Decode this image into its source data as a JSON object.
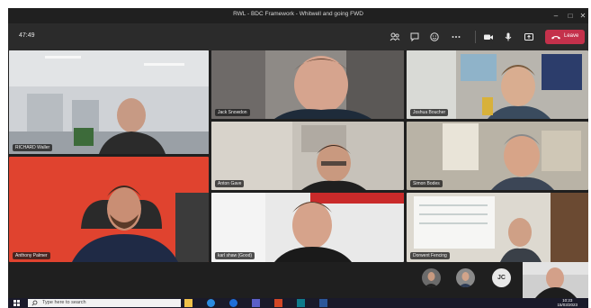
{
  "window": {
    "title": "RWL - BDC Framework - Whitwell and going FWD"
  },
  "toolbar": {
    "timer": "47:49",
    "leave_label": "Leave",
    "icons": [
      "people-icon",
      "chat-icon",
      "react-icon",
      "more-icon",
      "camera-icon",
      "mic-icon",
      "share-icon",
      "phone-icon"
    ]
  },
  "participants": [
    {
      "name": "RICHARD Waller"
    },
    {
      "name": "Jack Snowdon"
    },
    {
      "name": "Joshua Boucher"
    },
    {
      "name": "Anton Gave"
    },
    {
      "name": "Simon Bodes"
    },
    {
      "name": "Anthony Palmer"
    },
    {
      "name": "karl shaw (Good)"
    },
    {
      "name": "Dorwent Fencing"
    }
  ],
  "strip": {
    "initials": "JC"
  },
  "taskbar": {
    "search_placeholder": "Type here to search",
    "time": "10:23",
    "date": "15/03/2023"
  },
  "colors": {
    "leave": "#c4314b",
    "background": "#1f1f1f",
    "toolbar": "#2b2b2b"
  }
}
